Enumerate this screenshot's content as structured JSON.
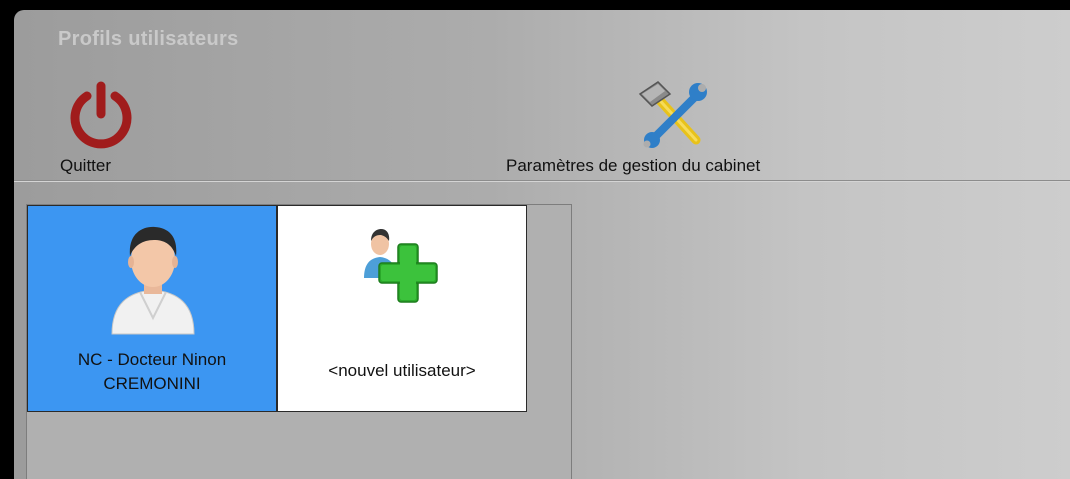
{
  "window": {
    "title": "Profils utilisateurs"
  },
  "ribbon": {
    "quit_label": "Quitter",
    "params_label": "Paramètres de gestion du cabinet",
    "quit_icon": "power-icon",
    "params_icon": "tools-icon"
  },
  "profiles": [
    {
      "label_line1": "NC - Docteur Ninon",
      "label_line2": "CREMONINI",
      "selected": true,
      "icon": "doctor-avatar-icon"
    },
    {
      "label": "<nouvel utilisateur>",
      "icon": "add-user-icon"
    }
  ],
  "colors": {
    "selected_tile": "#3c96f2",
    "power_icon": "#a01c1c",
    "add_icon": "#2aa82a"
  }
}
